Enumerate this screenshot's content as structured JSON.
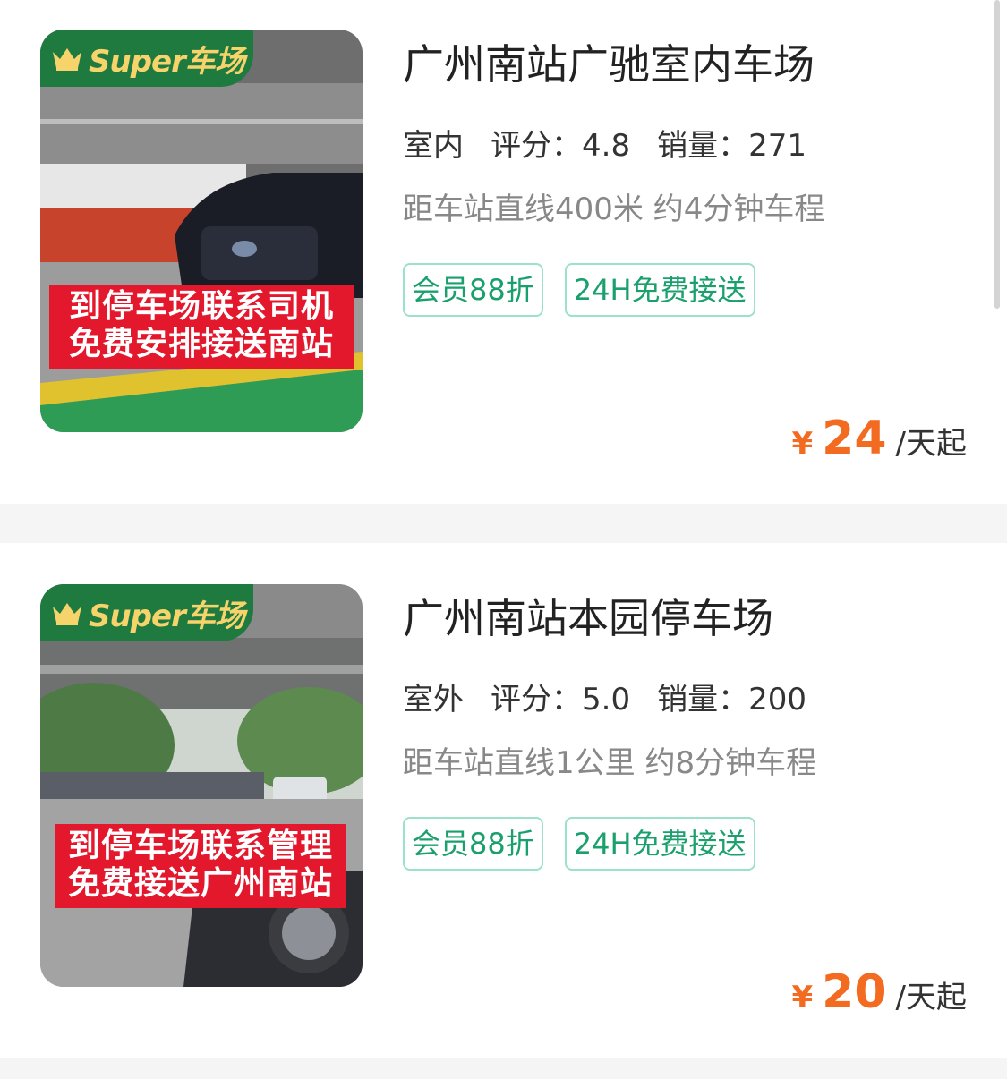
{
  "listings": [
    {
      "badge": "Super车场",
      "photo_caption_line1": "到停车场联系司机",
      "photo_caption_line2": "免费安排接送南站",
      "title": "广州南站广驰室内车场",
      "kind": "室内",
      "rating_label": "评分：",
      "rating": "4.8",
      "sales_label": "销量：",
      "sales": "271",
      "distance": "距车站直线400米 约4分钟车程",
      "tags": [
        "会员88折",
        "24H免费接送"
      ],
      "currency": "¥",
      "price": "24",
      "price_unit": "/天起"
    },
    {
      "badge": "Super车场",
      "photo_caption_line1": "到停车场联系管理",
      "photo_caption_line2": "免费接送广州南站",
      "title": "广州南站本园停车场",
      "kind": "室外",
      "rating_label": "评分：",
      "rating": "5.0",
      "sales_label": "销量：",
      "sales": "200",
      "distance": "距车站直线1公里 约8分钟车程",
      "tags": [
        "会员88折",
        "24H免费接送"
      ],
      "currency": "¥",
      "price": "20",
      "price_unit": "/天起"
    }
  ],
  "colors": {
    "badge_green": "#1e7a3f",
    "badge_gold": "#f6d36b",
    "banner_red": "#e3182d",
    "tag_green": "#1aa06d",
    "price_orange": "#f36b21"
  },
  "icons": [
    "crown-icon"
  ]
}
